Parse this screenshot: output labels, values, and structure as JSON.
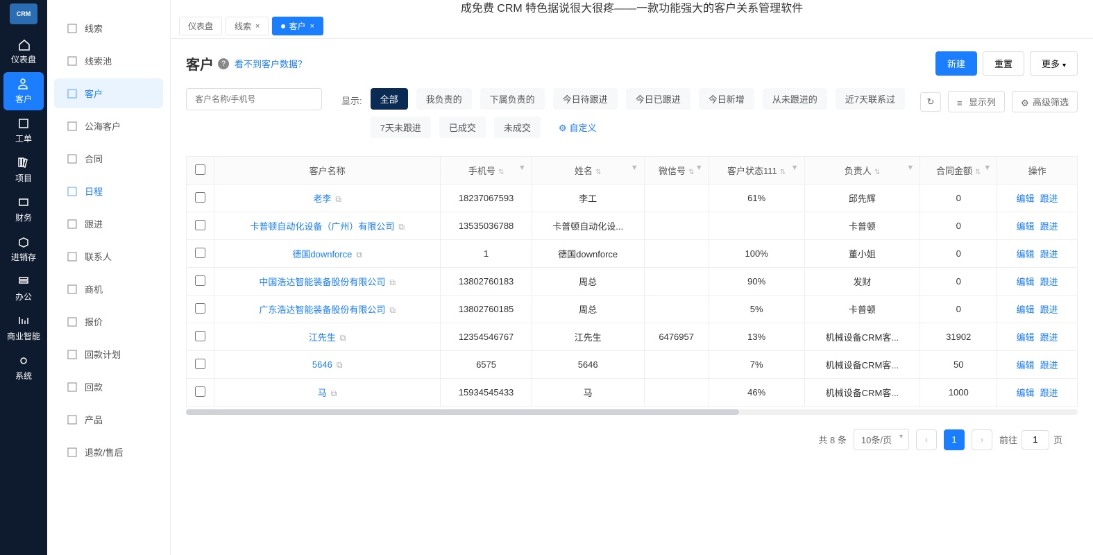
{
  "logo": "CRM",
  "topbar_title": "成免费 CRM 特色据说很大很疼——一款功能强大的客户关系管理软件",
  "nav1": [
    {
      "label": "仪表盘",
      "icon": "home"
    },
    {
      "label": "客户",
      "icon": "user",
      "active": true
    },
    {
      "label": "工单",
      "icon": "ticket"
    },
    {
      "label": "项目",
      "icon": "books"
    },
    {
      "label": "财务",
      "icon": "money"
    },
    {
      "label": "进销存",
      "icon": "box"
    },
    {
      "label": "办公",
      "icon": "office"
    },
    {
      "label": "商业智能",
      "icon": "chart"
    },
    {
      "label": "系统",
      "icon": "gear"
    }
  ],
  "nav2": [
    {
      "label": "线索"
    },
    {
      "label": "线索池"
    },
    {
      "label": "客户",
      "active": true
    },
    {
      "label": "公海客户"
    },
    {
      "label": "合同"
    },
    {
      "label": "日程",
      "blue": true
    },
    {
      "label": "跟进"
    },
    {
      "label": "联系人"
    },
    {
      "label": "商机"
    },
    {
      "label": "报价"
    },
    {
      "label": "回款计划"
    },
    {
      "label": "回款"
    },
    {
      "label": "产品"
    },
    {
      "label": "退款/售后"
    }
  ],
  "tabs": [
    {
      "label": "仪表盘"
    },
    {
      "label": "线索",
      "close": true
    },
    {
      "label": "客户",
      "close": true,
      "active": true
    }
  ],
  "page_title": "客户",
  "no_data_link": "看不到客户数据？",
  "buttons": {
    "new": "新建",
    "reset": "重置",
    "more": "更多"
  },
  "search_placeholder": "客户名称/手机号",
  "filter_label": "显示:",
  "filters1": [
    "全部",
    "我负责的",
    "下属负责的",
    "今日待跟进",
    "今日已跟进",
    "今日新增",
    "从未跟进的",
    "近7天联系过"
  ],
  "filters2": [
    "7天未跟进",
    "已成交",
    "未成交"
  ],
  "custom_filter": "自定义",
  "tools": {
    "cols": "显示列",
    "adv": "高级筛选"
  },
  "columns": [
    "客户名称",
    "手机号",
    "姓名",
    "微信号",
    "客户状态111",
    "负责人",
    "合同金额",
    "操作"
  ],
  "ops": {
    "edit": "编辑",
    "follow": "跟进"
  },
  "rows": [
    {
      "name": "老李",
      "phone": "18237067593",
      "contact": "李工",
      "wechat": "",
      "status": "61%",
      "owner": "邱先辉",
      "amount": "0"
    },
    {
      "name": "卡普顿自动化设备（广州）有限公司",
      "phone": "13535036788",
      "contact": "卡普顿自动化设...",
      "wechat": "",
      "status": "",
      "owner": "卡普顿",
      "amount": "0"
    },
    {
      "name": "德国downforce",
      "phone": "1",
      "contact": "德国downforce",
      "wechat": "",
      "status": "100%",
      "owner": "董小姐",
      "amount": "0"
    },
    {
      "name": "中国浩达智能装备股份有限公司",
      "phone": "13802760183",
      "contact": "周总",
      "wechat": "",
      "status": "90%",
      "owner": "发财",
      "amount": "0"
    },
    {
      "name": "广东浩达智能装备股份有限公司",
      "phone": "13802760185",
      "contact": "周总",
      "wechat": "",
      "status": "5%",
      "owner": "卡普顿",
      "amount": "0"
    },
    {
      "name": "江先生",
      "phone": "12354546767",
      "contact": "江先生",
      "wechat": "6476957",
      "status": "13%",
      "owner": "机械设备CRM客...",
      "amount": "31902"
    },
    {
      "name": "5646",
      "phone": "6575",
      "contact": "5646",
      "wechat": "",
      "status": "7%",
      "owner": "机械设备CRM客...",
      "amount": "50"
    },
    {
      "name": "马",
      "phone": "15934545433",
      "contact": "马",
      "wechat": "",
      "status": "46%",
      "owner": "机械设备CRM客...",
      "amount": "1000"
    }
  ],
  "pager": {
    "total": "共 8 条",
    "size": "10条/页",
    "current": "1",
    "goto": "前往",
    "goval": "1",
    "unit": "页"
  }
}
